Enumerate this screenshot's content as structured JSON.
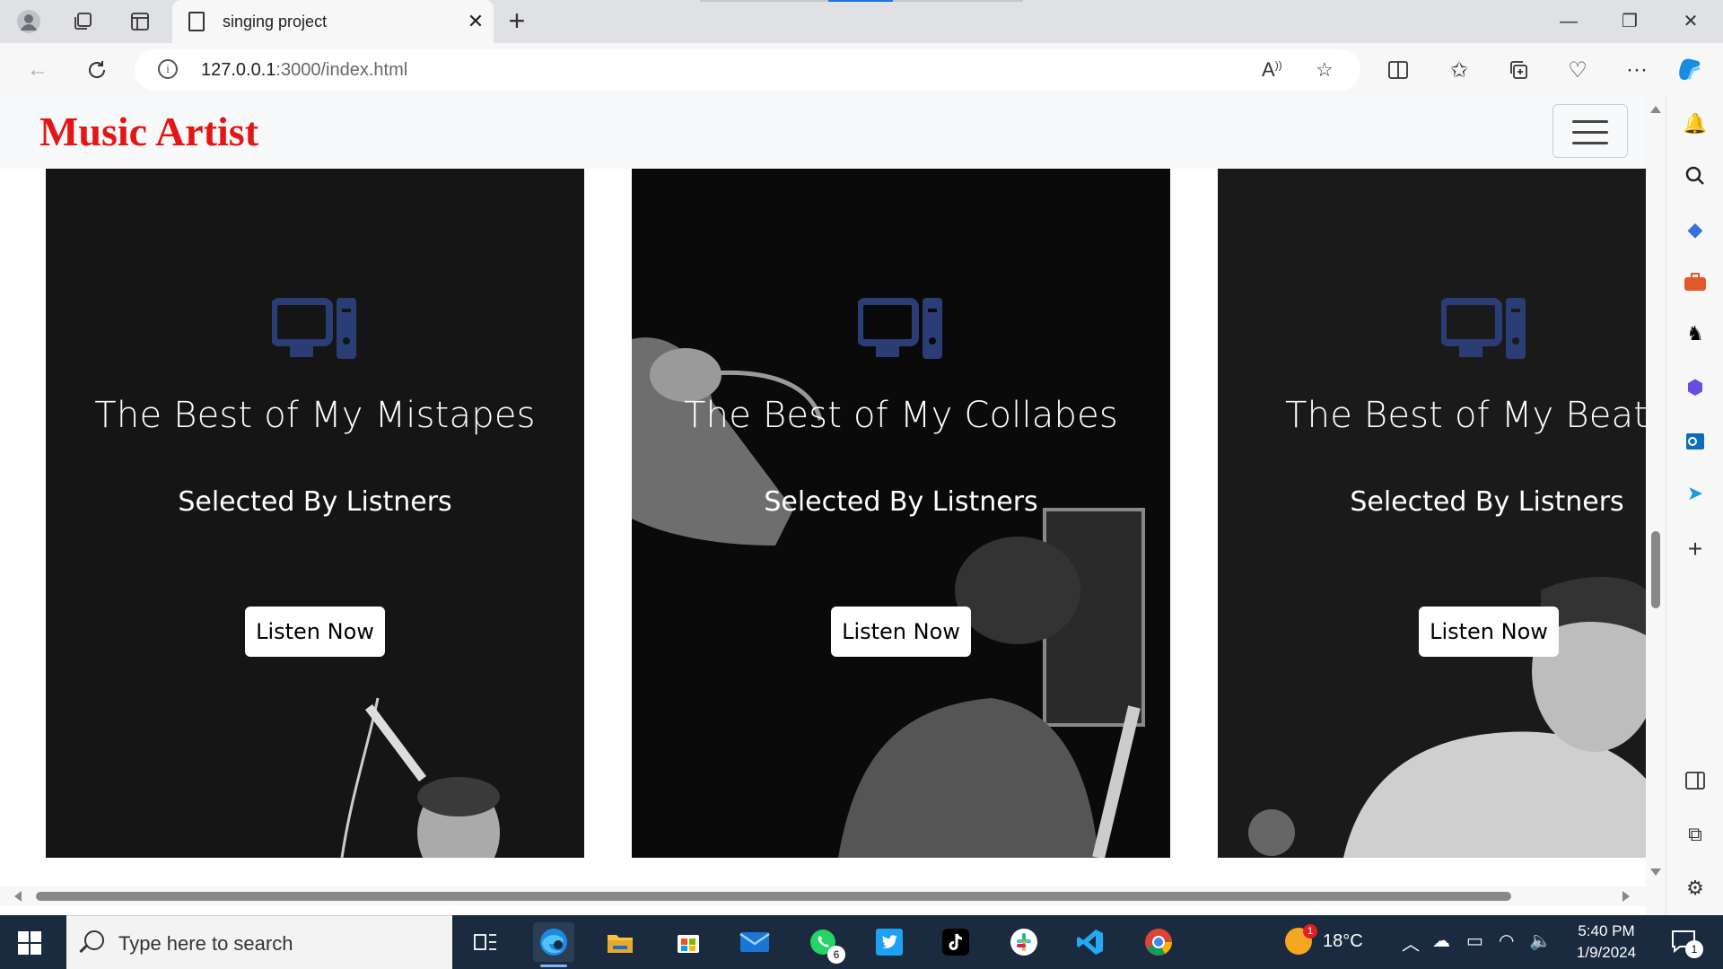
{
  "browser": {
    "tab_title": "singing project",
    "url_host": "127.0.0.1",
    "url_rest": ":3000/index.html"
  },
  "site": {
    "brand": "Music Artist",
    "cards": [
      {
        "title": "The Best of My Mistapes",
        "subtitle": "Selected By Listners",
        "button": "Listen Now"
      },
      {
        "title": "The Best of My Collabes",
        "subtitle": "Selected By Listners",
        "button": "Listen Now"
      },
      {
        "title": "The Best of My Beates",
        "subtitle": "Selected By Listners",
        "button": "Listen Now"
      }
    ],
    "icon_color": "#2a3d75",
    "brand_color": "#e31616"
  },
  "taskbar": {
    "search_placeholder": "Type here to search",
    "whatsapp_badge": "6",
    "weather_badge": "1",
    "temperature": "18°C",
    "time": "5:40 PM",
    "date": "1/9/2024",
    "notification_count": "1"
  }
}
